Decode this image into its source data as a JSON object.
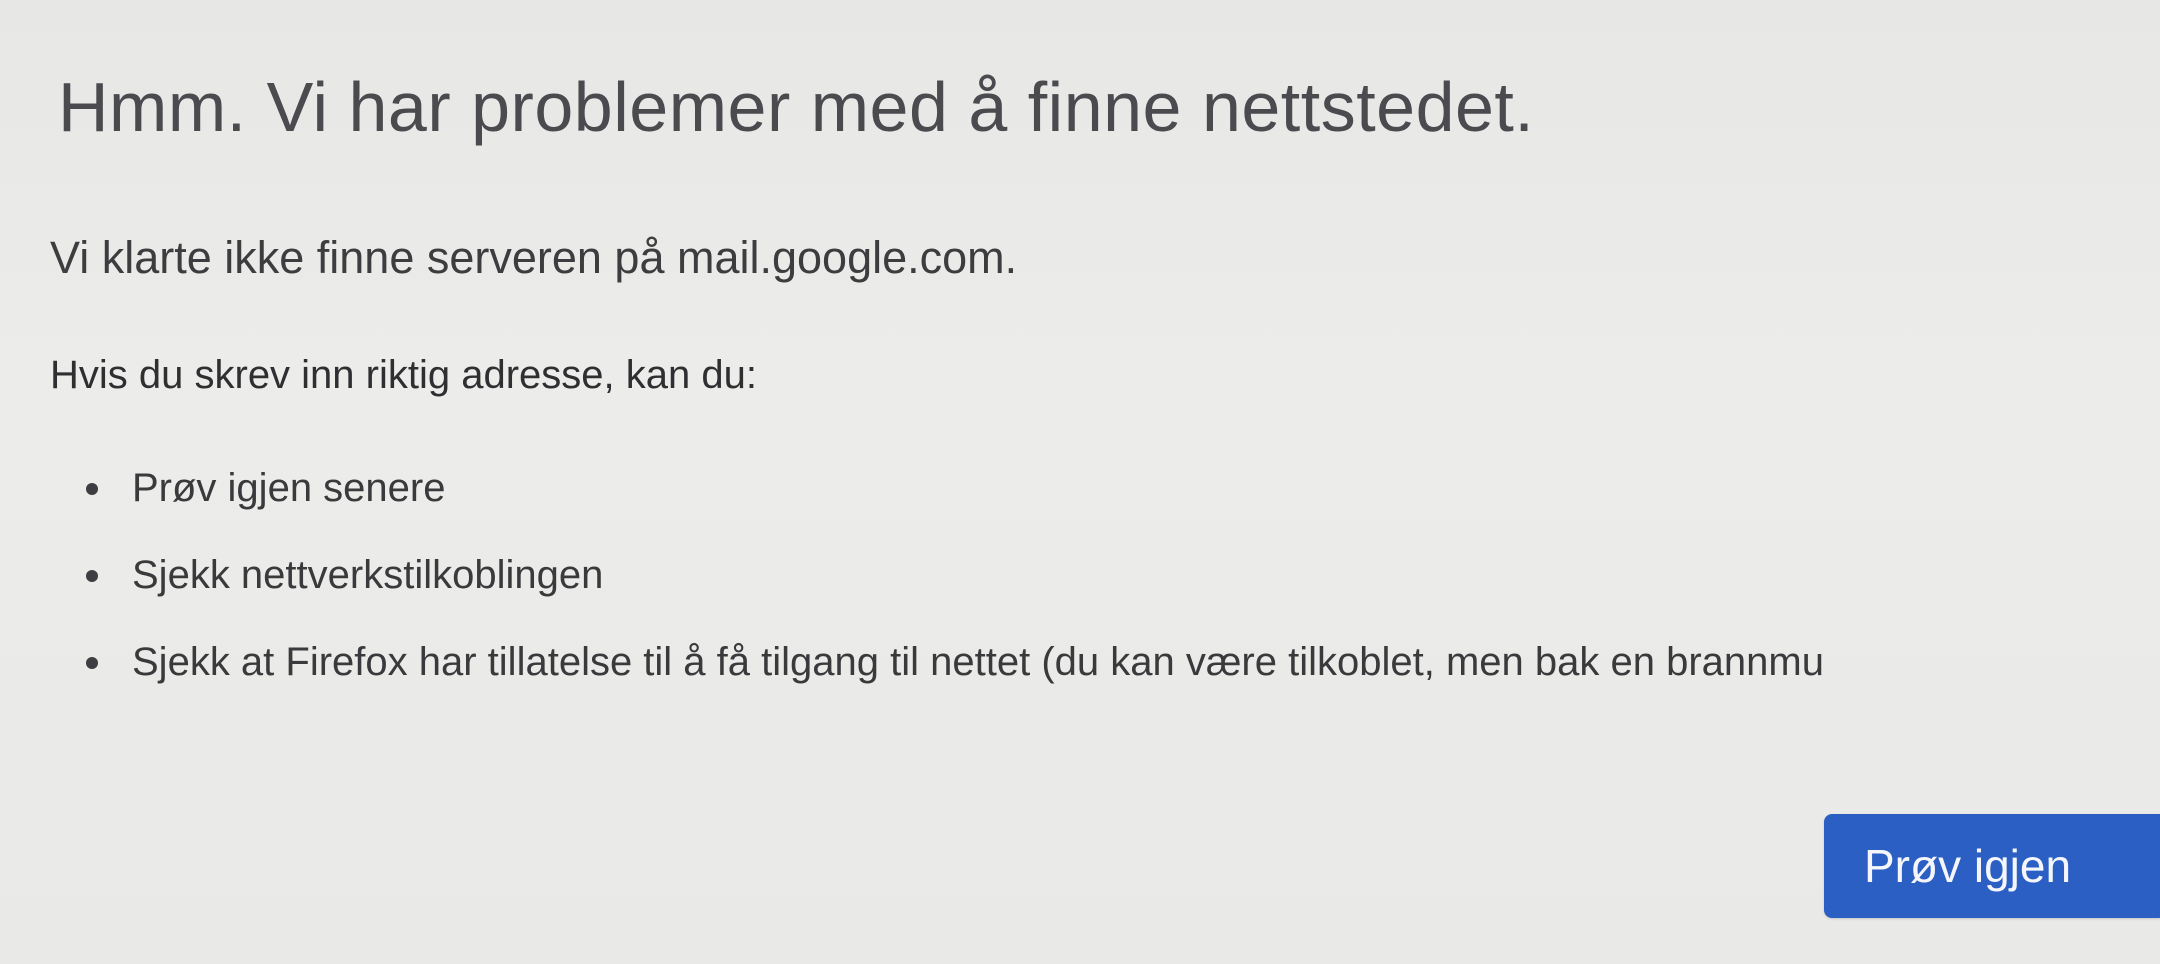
{
  "error_page": {
    "title": "Hmm. Vi har problemer med å finne nettstedet.",
    "message": "Vi klarte ikke finne serveren på mail.google.com.",
    "advice_heading": "Hvis du skrev inn riktig adresse, kan du:",
    "advice_items": [
      {
        "label": "Prøv igjen senere"
      },
      {
        "label": "Sjekk nettverkstilkoblingen"
      },
      {
        "label": "Sjekk at Firefox har tillatelse til å få tilgang til nettet (du kan være tilkoblet, men bak en brannmu"
      }
    ],
    "retry_label": "Prøv igjen"
  },
  "colors": {
    "background": "#e9e9e7",
    "text": "#3b3b3d",
    "button": "#2b5fc4",
    "button_text": "#f4f6fb"
  },
  "icons": {
    "bullet": "bullet-icon"
  }
}
